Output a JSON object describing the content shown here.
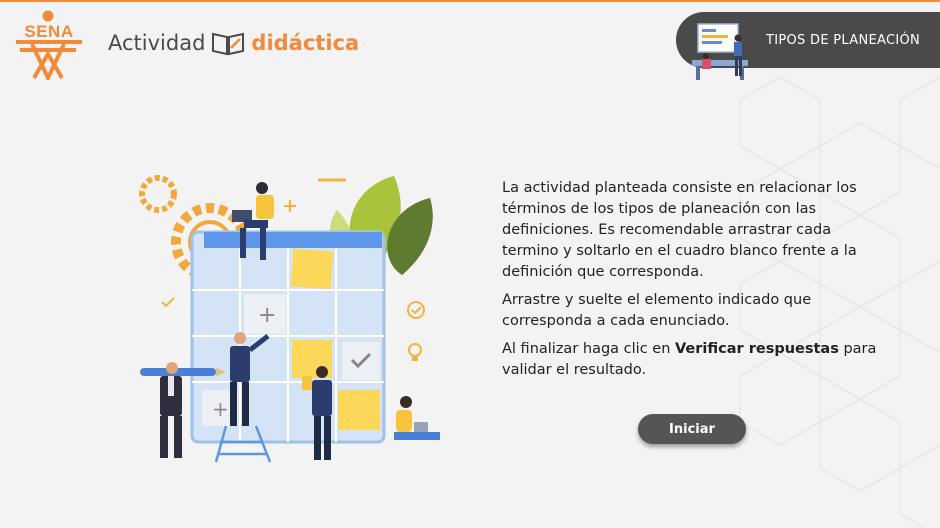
{
  "header": {
    "logo_text": "SENA",
    "title_part1": "Actividad",
    "title_part2": "didáctica",
    "section_label": "TIPOS DE PLANEACIÓN"
  },
  "main": {
    "intro_paragraph": "La actividad planteada consiste en relacionar los términos de los tipos de planeación con las definiciones.  Es recomendable arrastrar cada termino y soltarlo en el cuadro blanco frente a la definición que corresponda.",
    "instruction_paragraph": "Arrastre y suelte el elemento indicado que corresponda a cada enunciado.",
    "final_prefix": "Al finalizar haga clic en ",
    "final_bold": "Verificar respuestas",
    "final_suffix": " para validar el resultado.",
    "start_button": "Iniciar"
  },
  "colors": {
    "accent_orange": "#f28a3c",
    "dark_gray": "#4a4a4a",
    "button_gray": "#555555"
  }
}
